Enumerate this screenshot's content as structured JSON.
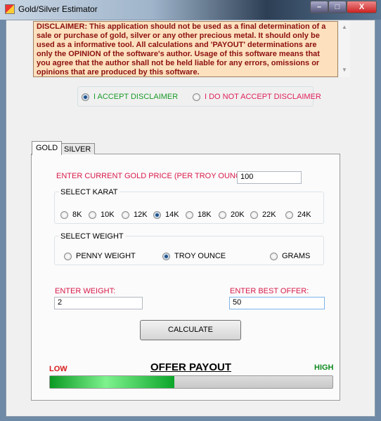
{
  "window": {
    "title": "Gold/Silver Estimator",
    "minimize": "–",
    "maximize": "□",
    "close": "X"
  },
  "disclaimer": "DISCLAIMER:  This application should not be used as a final determination of a sale or purchase of gold, silver or any other precious metal.  It should only be used as a informative tool. All calculations and 'PAYOUT' determinations are only the OPINION of the software's author.  Usage of this software means that you agree that the author shall not be held liable for any errors, omissions or opinions that are produced by this software.",
  "accept": {
    "yes": "I ACCEPT DISCLAIMER",
    "no": "I DO NOT ACCEPT DISCLAIMER",
    "selected": "yes"
  },
  "tabs": [
    "GOLD",
    "SILVER"
  ],
  "gold": {
    "price_label": "ENTER CURRENT GOLD PRICE (PER TROY OUNCE):",
    "price": "100",
    "karat_label": "SELECT KARAT",
    "karats": [
      "8K",
      "10K",
      "12K",
      "14K",
      "18K",
      "20K",
      "22K",
      "24K"
    ],
    "karat_selected": "14K",
    "weight_label": "SELECT WEIGHT",
    "weights": [
      "PENNY WEIGHT",
      "TROY OUNCE",
      "GRAMS"
    ],
    "weight_selected": "TROY OUNCE",
    "enter_weight_label": "ENTER WEIGHT:",
    "weight": "2",
    "offer_label": "ENTER BEST OFFER:",
    "offer": "50",
    "calculate": "CALCULATE"
  },
  "payout": {
    "title": "OFFER PAYOUT",
    "low": "LOW",
    "high": "HIGH",
    "percent": 44
  },
  "colors": {
    "accept": "#1a9a2a",
    "reject": "#e0205a",
    "label_red": "#d81a4a",
    "disclaimer_bg": "#fde0bd"
  }
}
